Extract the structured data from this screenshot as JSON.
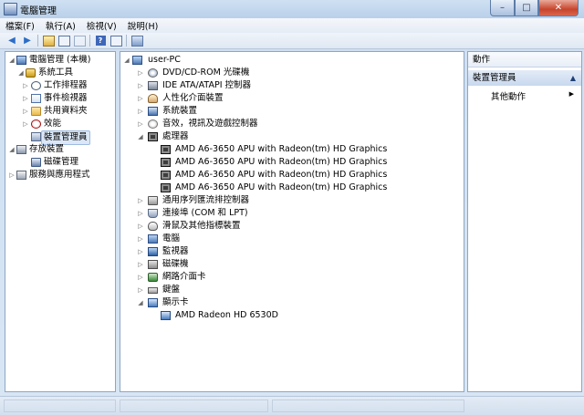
{
  "window": {
    "title": "電腦管理",
    "controls": {
      "minimize": "–",
      "maximize": "□",
      "close": "✕"
    }
  },
  "menu": [
    "檔案(F)",
    "執行(A)",
    "檢視(V)",
    "說明(H)"
  ],
  "toolbar": [
    "back-icon",
    "forward-icon",
    "up-icon",
    "show-tree-icon",
    "export-icon",
    "help-icon",
    "properties-icon",
    "scan-icon"
  ],
  "left_tree": [
    {
      "label": "電腦管理 (本機)",
      "icon": "computer-management-icon"
    },
    {
      "label": "系統工具",
      "icon": "system-tools-icon"
    },
    {
      "label": "工作排程器",
      "icon": "task-scheduler-icon"
    },
    {
      "label": "事件檢視器",
      "icon": "event-viewer-icon"
    },
    {
      "label": "共用資料夾",
      "icon": "shared-folders-icon"
    },
    {
      "label": "效能",
      "icon": "performance-icon"
    },
    {
      "label": "裝置管理員",
      "icon": "device-manager-icon",
      "selected": true
    },
    {
      "label": "存放裝置",
      "icon": "storage-icon"
    },
    {
      "label": "磁碟管理",
      "icon": "disk-management-icon"
    },
    {
      "label": "服務與應用程式",
      "icon": "services-icon"
    }
  ],
  "device_tree": {
    "root": "user-PC",
    "categories": [
      {
        "label": "DVD/CD-ROM 光碟機",
        "icon": "dvd-icon"
      },
      {
        "label": "IDE ATA/ATAPI 控制器",
        "icon": "ide-controller-icon"
      },
      {
        "label": "人性化介面裝置",
        "icon": "hid-icon"
      },
      {
        "label": "系統裝置",
        "icon": "system-devices-icon"
      },
      {
        "label": "音效，視訊及遊戲控制器",
        "icon": "audio-icon"
      },
      {
        "label": "處理器",
        "icon": "processor-icon",
        "expanded": true,
        "children": [
          "AMD A6-3650 APU with Radeon(tm) HD Graphics",
          "AMD A6-3650 APU with Radeon(tm) HD Graphics",
          "AMD A6-3650 APU with Radeon(tm) HD Graphics",
          "AMD A6-3650 APU with Radeon(tm) HD Graphics"
        ]
      },
      {
        "label": "通用序列匯流排控制器",
        "icon": "usb-icon"
      },
      {
        "label": "連接埠 (COM 和 LPT)",
        "icon": "port-icon"
      },
      {
        "label": "滑鼠及其他指標裝置",
        "icon": "mouse-icon"
      },
      {
        "label": "電腦",
        "icon": "computer-icon"
      },
      {
        "label": "監視器",
        "icon": "monitor-icon"
      },
      {
        "label": "磁碟機",
        "icon": "disk-drive-icon"
      },
      {
        "label": "網路介面卡",
        "icon": "network-adapter-icon"
      },
      {
        "label": "鍵盤",
        "icon": "keyboard-icon"
      },
      {
        "label": "顯示卡",
        "icon": "display-adapter-icon",
        "expanded": true,
        "children": [
          "AMD Radeon HD 6530D"
        ]
      }
    ]
  },
  "actions": {
    "header": "動作",
    "section": "裝置管理員",
    "items": [
      "其他動作"
    ]
  }
}
